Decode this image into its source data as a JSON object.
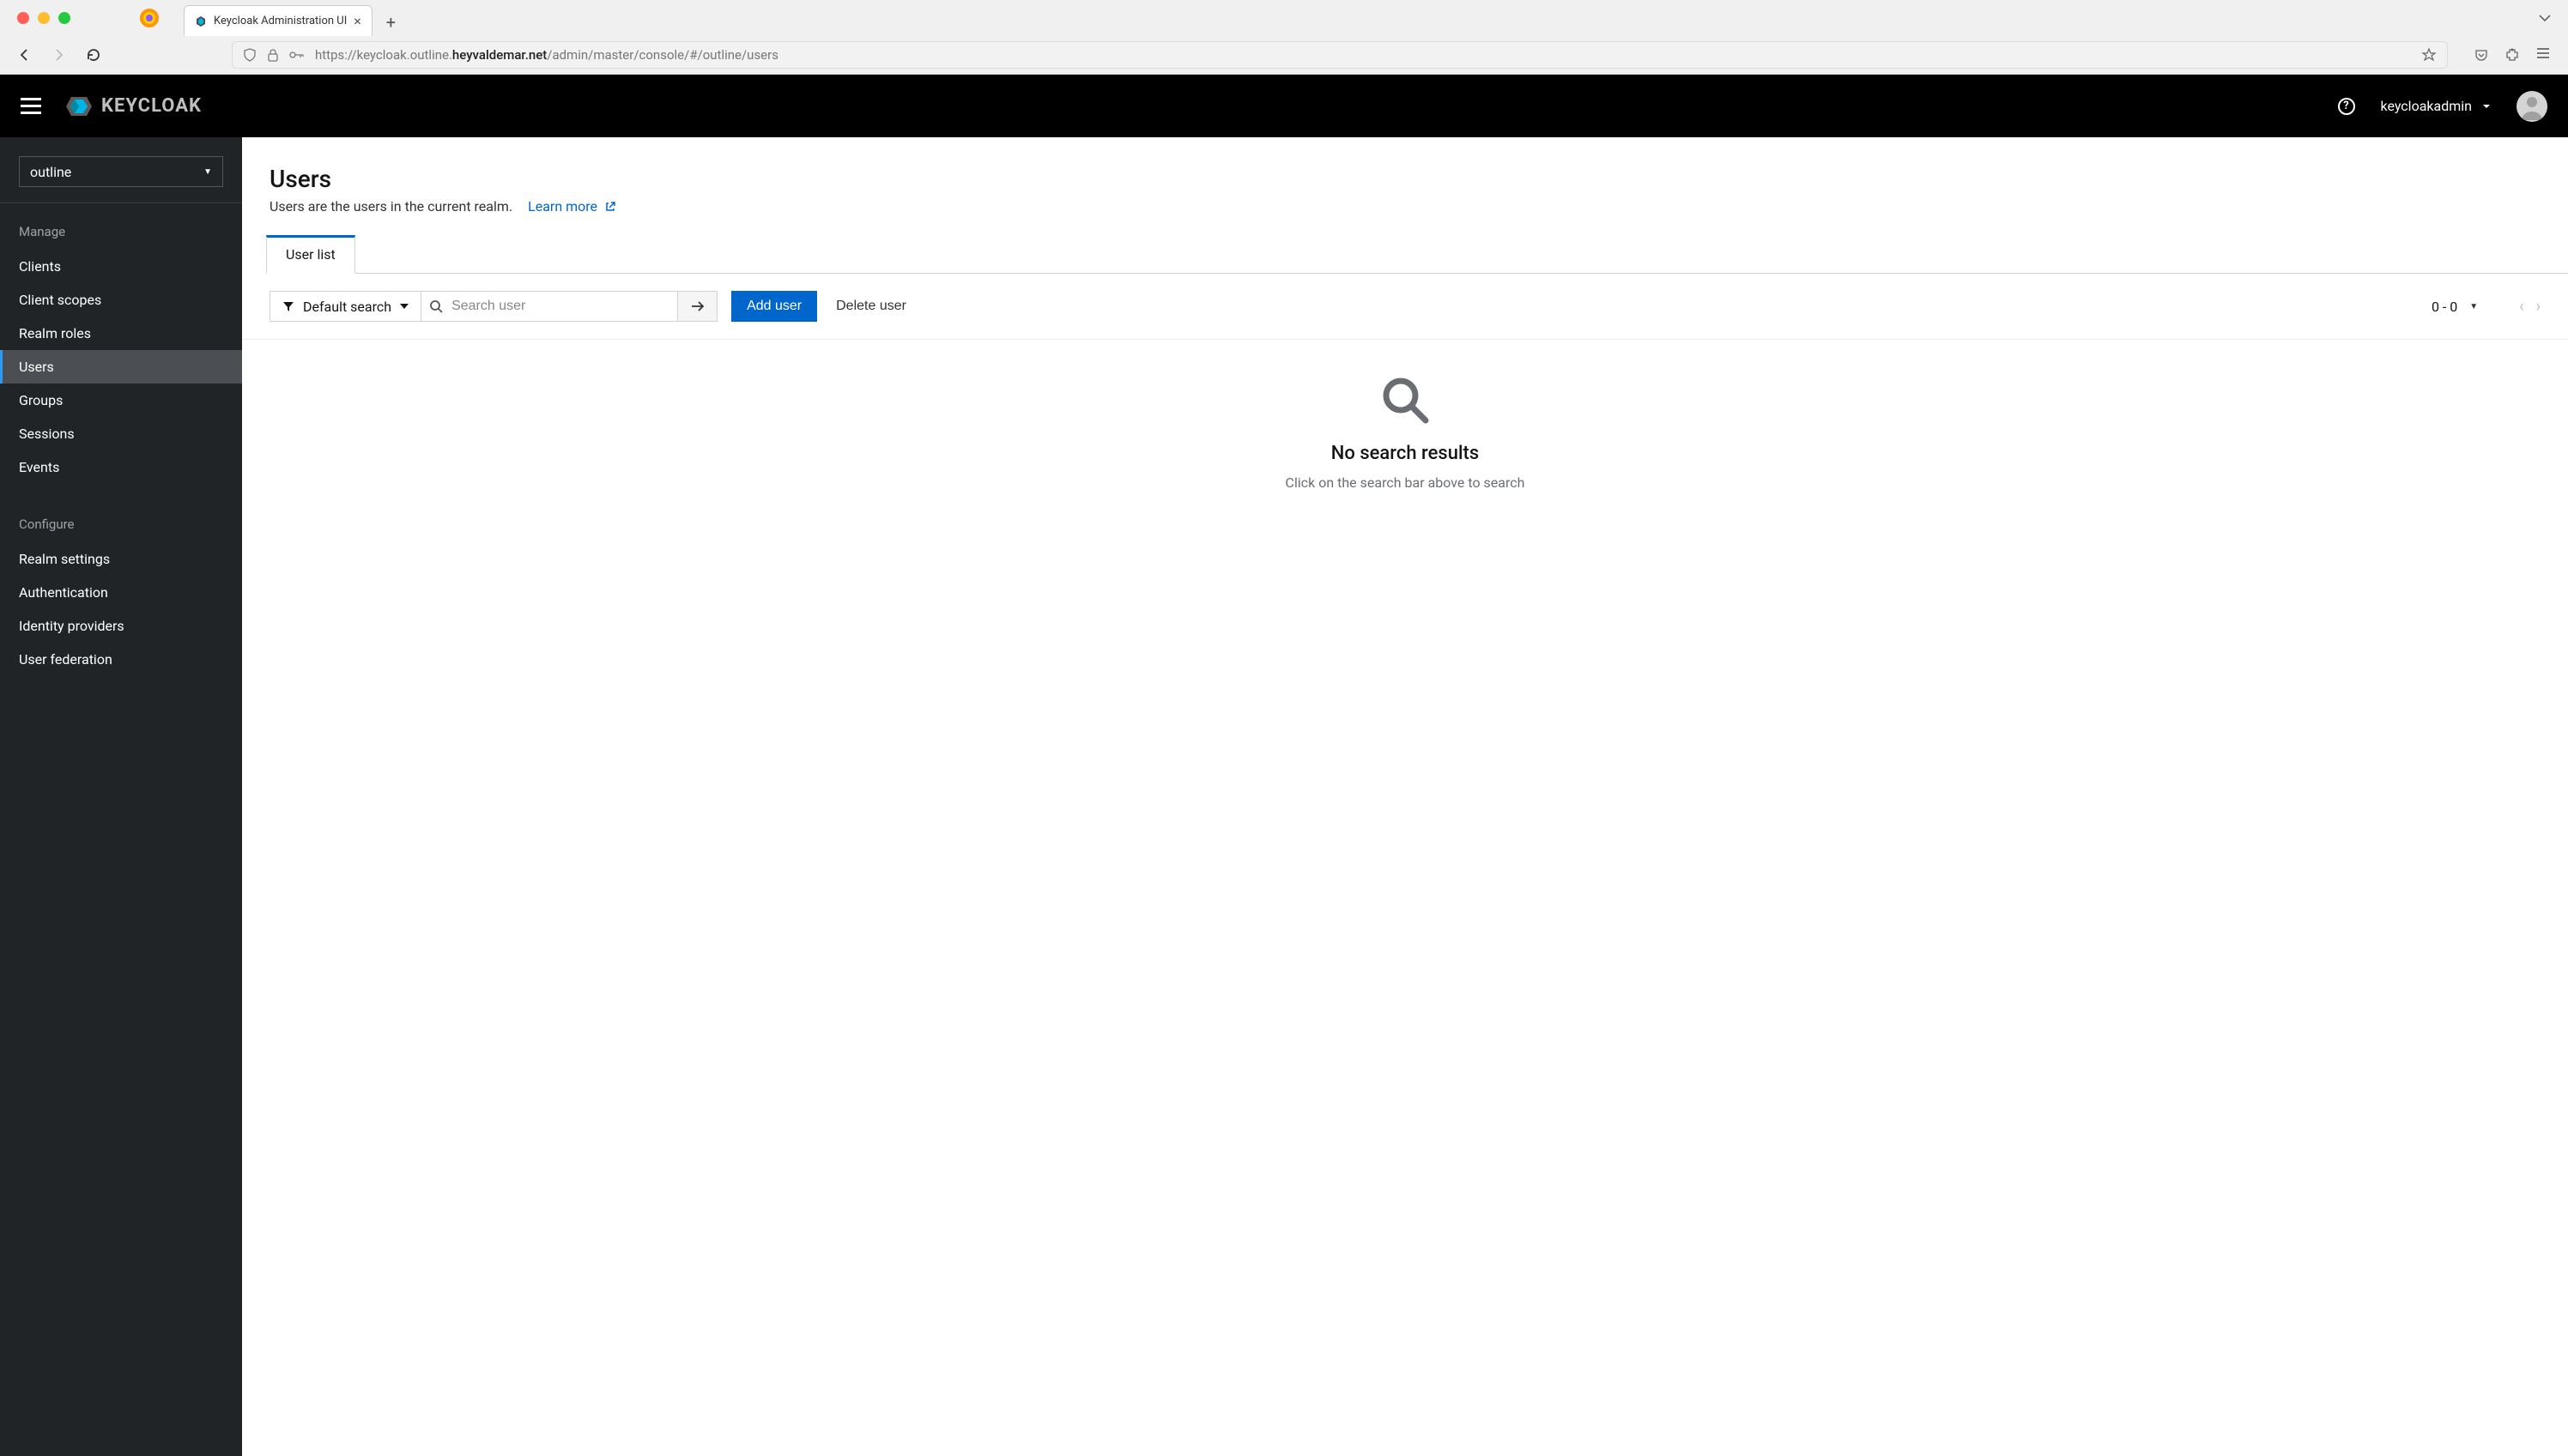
{
  "browser": {
    "tab_title": "Keycloak Administration UI",
    "url_prefix": "https://keycloak.outline.",
    "url_bold": "heyvaldemar.net",
    "url_suffix": "/admin/master/console/#/outline/users"
  },
  "header": {
    "logo_text": "KEYCLOAK",
    "username": "keycloakadmin"
  },
  "sidebar": {
    "realm": "outline",
    "section_manage": "Manage",
    "section_configure": "Configure",
    "items_manage": [
      {
        "label": "Clients",
        "active": false
      },
      {
        "label": "Client scopes",
        "active": false
      },
      {
        "label": "Realm roles",
        "active": false
      },
      {
        "label": "Users",
        "active": true
      },
      {
        "label": "Groups",
        "active": false
      },
      {
        "label": "Sessions",
        "active": false
      },
      {
        "label": "Events",
        "active": false
      }
    ],
    "items_configure": [
      {
        "label": "Realm settings"
      },
      {
        "label": "Authentication"
      },
      {
        "label": "Identity providers"
      },
      {
        "label": "User federation"
      }
    ]
  },
  "page": {
    "title": "Users",
    "description": "Users are the users in the current realm.",
    "learn_more": "Learn more",
    "tab_label": "User list"
  },
  "toolbar": {
    "filter_label": "Default search",
    "search_placeholder": "Search user",
    "add_user_label": "Add user",
    "delete_user_label": "Delete user",
    "pager_label": "0 - 0"
  },
  "empty": {
    "title": "No search results",
    "description": "Click on the search bar above to search"
  }
}
